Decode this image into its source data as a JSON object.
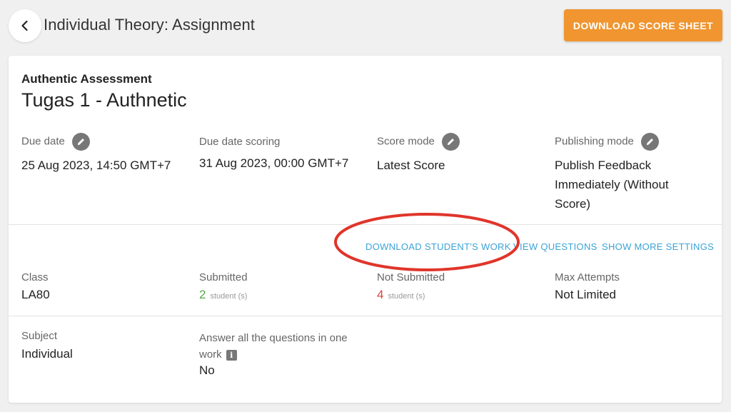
{
  "header": {
    "title": "Individual Theory: Assignment",
    "download_score_label": "DOWNLOAD SCORE SHEET"
  },
  "assessment": {
    "type": "Authentic Assessment",
    "name": "Tugas 1 - Authnetic"
  },
  "details": {
    "due_date": {
      "label": "Due date",
      "value": "25 Aug 2023, 14:50 GMT+7"
    },
    "due_date_scoring": {
      "label": "Due date scoring",
      "value": "31 Aug 2023, 00:00 GMT+7"
    },
    "score_mode": {
      "label": "Score mode",
      "value": "Latest Score"
    },
    "publishing_mode": {
      "label": "Publishing mode",
      "value_lines": [
        "Publish Feedback",
        "Immediately (Without",
        "Score)"
      ]
    }
  },
  "actions": {
    "download_work": "DOWNLOAD STUDENT'S WORK",
    "view_questions": "VIEW QUESTIONS",
    "show_more": "SHOW MORE SETTINGS"
  },
  "stats": {
    "class": {
      "label": "Class",
      "value": "LA80"
    },
    "submitted": {
      "label": "Submitted",
      "count": "2",
      "unit": "student (s)"
    },
    "not_submitted": {
      "label": "Not Submitted",
      "count": "4",
      "unit": "student (s)"
    },
    "max_attempts": {
      "label": "Max Attempts",
      "value": "Not Limited"
    }
  },
  "extra": {
    "subject": {
      "label": "Subject",
      "value": "Individual"
    },
    "answer_all": {
      "label_line1": "Answer all the questions in one",
      "label_line2": "work",
      "info_glyph": "i",
      "value": "No"
    }
  },
  "icons": {
    "back": "chevron-left-icon",
    "edit": "pencil-icon",
    "info": "info-icon"
  },
  "colors": {
    "accent_orange": "#f0952f",
    "link_blue": "#3ba3d6",
    "submitted_green": "#56a84a",
    "not_submitted_red": "#d9463b",
    "annotation_red": "#e0352b"
  }
}
